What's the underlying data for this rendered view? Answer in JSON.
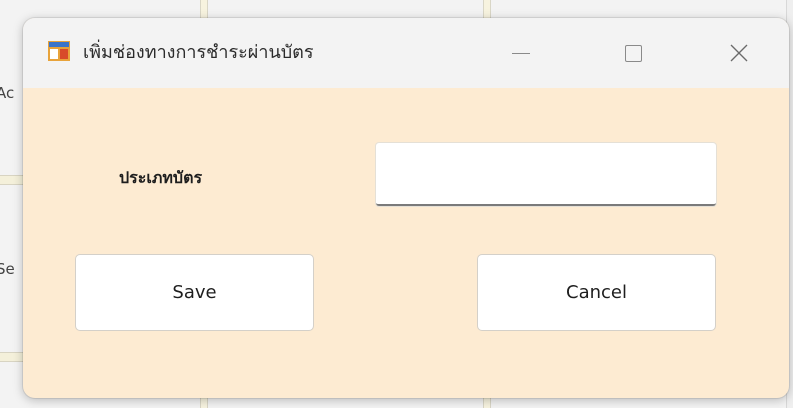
{
  "window": {
    "title": "เพิ่มช่องทางการชำระผ่านบัตร",
    "app_icon": "windows-form-icon",
    "minimize_icon": "minimize-icon",
    "maximize_icon": "maximize-icon",
    "close_icon": "close-icon",
    "close_glyph": "✕"
  },
  "background": {
    "fragment_1": "Ac",
    "fragment_2": "Se"
  },
  "form": {
    "field_label": "ประเภทบัตร",
    "field_value": "",
    "save_label": "Save",
    "cancel_label": "Cancel"
  },
  "colors": {
    "dialog_body": "#fdebd2",
    "titlebar": "#f3f3f3",
    "button_bg": "#ffffff"
  }
}
